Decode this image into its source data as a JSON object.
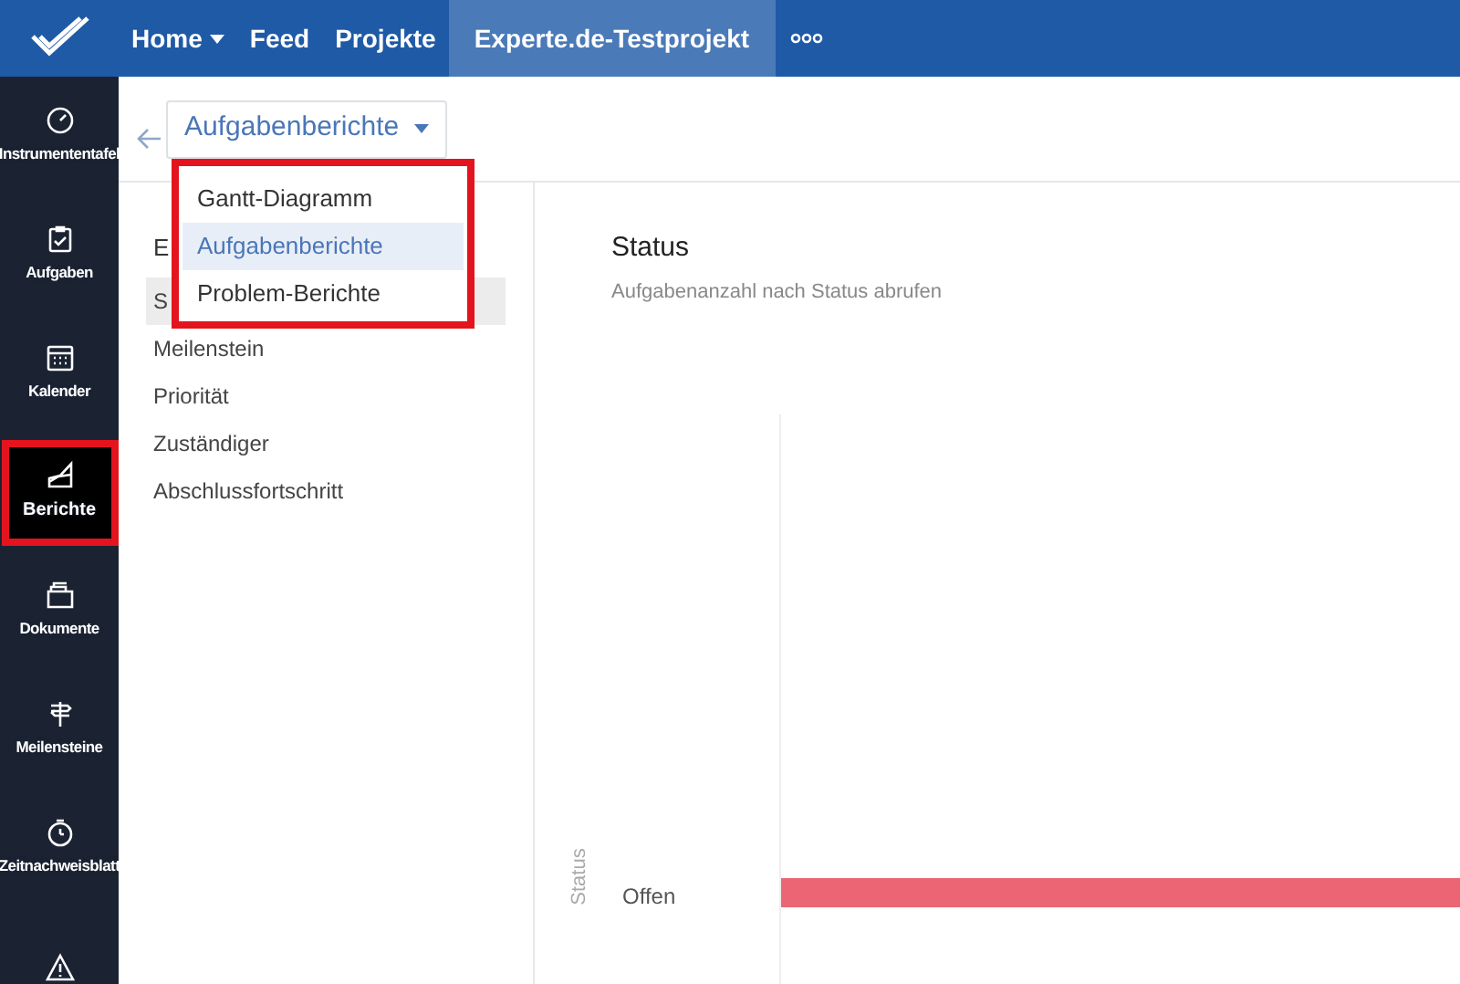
{
  "top_nav": {
    "items": [
      {
        "label": "Home",
        "dropdown": true,
        "selected": false
      },
      {
        "label": "Feed",
        "dropdown": false,
        "selected": false
      },
      {
        "label": "Projekte",
        "dropdown": false,
        "selected": false
      },
      {
        "label": "Experte.de-Testprojekt",
        "dropdown": false,
        "selected": true
      }
    ]
  },
  "sidebar": {
    "items": [
      {
        "label": "Instrumententafel",
        "kind": "gauge",
        "selected": false
      },
      {
        "label": "Aufgaben",
        "kind": "clipboard",
        "selected": false
      },
      {
        "label": "Kalender",
        "kind": "calendar",
        "selected": false
      },
      {
        "label": "Berichte",
        "kind": "chart",
        "selected": true
      },
      {
        "label": "Dokumente",
        "kind": "folder",
        "selected": false
      },
      {
        "label": "Meilensteine",
        "kind": "signpost",
        "selected": false
      },
      {
        "label": "Zeitnachweisblatt",
        "kind": "timer",
        "selected": false
      },
      {
        "kind": "warning",
        "selected": false
      }
    ]
  },
  "report_select": {
    "value": "Aufgabenberichte",
    "options": [
      {
        "label": "Gantt-Diagramm",
        "selected": false
      },
      {
        "label": "Aufgabenberichte",
        "selected": true
      },
      {
        "label": "Problem-Berichte",
        "selected": false
      }
    ]
  },
  "report_list": {
    "heading": "E",
    "items": [
      {
        "label": "S",
        "selected": true
      },
      {
        "label": "Meilenstein",
        "selected": false
      },
      {
        "label": "Priorität",
        "selected": false
      },
      {
        "label": "Zuständiger",
        "selected": false
      },
      {
        "label": "Abschlussfortschritt",
        "selected": false
      }
    ]
  },
  "panel": {
    "title": "Status",
    "subtitle": "Aufgabenanzahl nach Status abrufen",
    "axis_label": "Status",
    "category": "Offen"
  }
}
